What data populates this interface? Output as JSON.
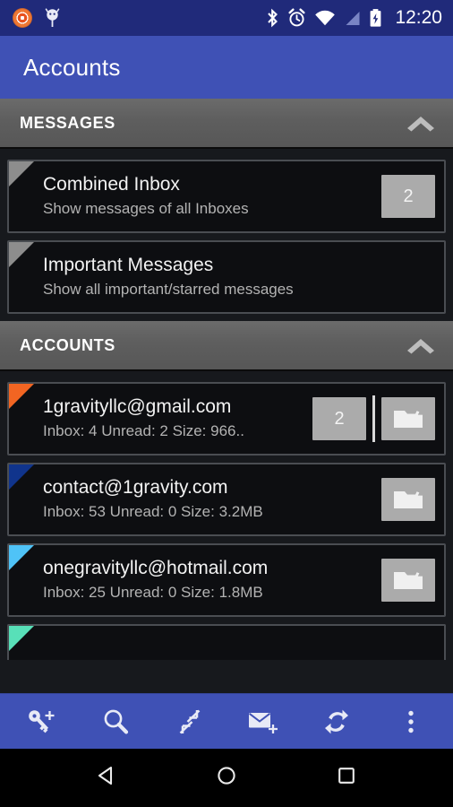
{
  "statusbar": {
    "time": "12:20",
    "left_icons": [
      {
        "name": "vlc-media-icon"
      },
      {
        "name": "android-debug-icon"
      }
    ],
    "right_icons": [
      {
        "name": "bluetooth-icon"
      },
      {
        "name": "alarm-clock-icon"
      },
      {
        "name": "wifi-icon"
      },
      {
        "name": "cellular-signal-icon"
      },
      {
        "name": "battery-charging-icon"
      }
    ]
  },
  "appbar": {
    "title": "Accounts"
  },
  "sections": [
    {
      "id": "messages",
      "title": "MESSAGES",
      "chevron_icon": "chevron-up-icon",
      "expanded": true,
      "rows": [
        {
          "title": "Combined Inbox",
          "subtitle": "Show messages of all Inboxes",
          "corner_color": "#8d8d8d",
          "badge": "2",
          "has_badge": true,
          "has_folder": false,
          "folder_icon": "folder-icon"
        },
        {
          "title": "Important Messages",
          "subtitle": "Show all important/starred messages",
          "corner_color": "#8d8d8d",
          "badge": "",
          "has_badge": false,
          "has_folder": false,
          "folder_icon": "folder-icon"
        }
      ]
    },
    {
      "id": "accounts",
      "title": "ACCOUNTS",
      "chevron_icon": "chevron-up-icon",
      "expanded": true,
      "rows": [
        {
          "title": "1gravityllc@gmail.com",
          "subtitle": "Inbox: 4   Unread: 2   Size: 966..",
          "corner_color": "#f26522",
          "badge": "2",
          "has_badge": true,
          "has_folder": true,
          "folder_icon": "folder-icon"
        },
        {
          "title": "contact@1gravity.com",
          "subtitle": "Inbox: 53   Unread: 0   Size: 3.2MB",
          "corner_color": "#10348c",
          "badge": "",
          "has_badge": false,
          "has_folder": true,
          "folder_icon": "folder-icon"
        },
        {
          "title": "onegravityllc@hotmail.com",
          "subtitle": "Inbox: 25   Unread: 0   Size: 1.8MB",
          "corner_color": "#4fc3f7",
          "badge": "",
          "has_badge": false,
          "has_folder": true,
          "folder_icon": "folder-icon"
        }
      ],
      "partial_row": {
        "corner_color": "#58e0b8"
      }
    }
  ],
  "toolbar": {
    "buttons": [
      {
        "name": "add-account-button",
        "icon": "key-plus-icon"
      },
      {
        "name": "search-button",
        "icon": "search-icon"
      },
      {
        "name": "collapse-all-button",
        "icon": "collapse-arrows-icon"
      },
      {
        "name": "compose-button",
        "icon": "envelope-plus-icon"
      },
      {
        "name": "refresh-button",
        "icon": "sync-refresh-icon"
      },
      {
        "name": "overflow-menu-button",
        "icon": "more-vertical-icon"
      }
    ]
  },
  "navbar": {
    "buttons": [
      {
        "name": "nav-back-button",
        "icon": "triangle-back-icon"
      },
      {
        "name": "nav-home-button",
        "icon": "circle-home-icon"
      },
      {
        "name": "nav-recents-button",
        "icon": "square-recents-icon"
      }
    ]
  },
  "colors": {
    "accent": "#3f51b5",
    "statusbar": "#202a7a",
    "section_header": "#5e5e5e",
    "row_bg": "#0d0e11",
    "badge_bg": "#ababab"
  }
}
